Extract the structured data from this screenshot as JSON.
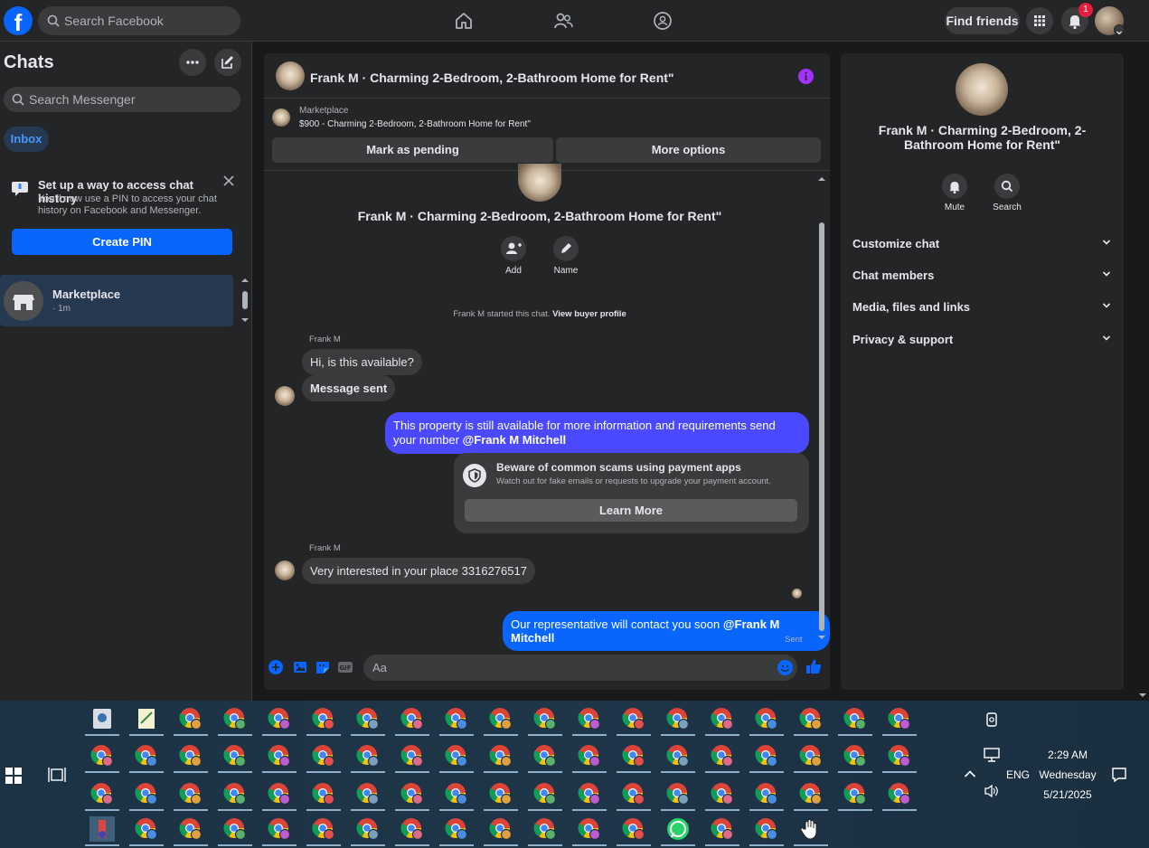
{
  "topbar": {
    "logo_letter": "f",
    "search_placeholder": "Search Facebook",
    "nav_icons": [
      "home-icon",
      "friends-icon",
      "groups-icon"
    ],
    "find_friends": "Find friends",
    "notif_count": "1"
  },
  "sidebar": {
    "title": "Chats",
    "search_placeholder": "Search Messenger",
    "inbox_label": "Inbox",
    "setup": {
      "title": "Set up a way to access chat history",
      "body": "You'll now use a PIN to access your chat history on Facebook and Messenger.",
      "button": "Create PIN"
    },
    "threads": [
      {
        "name": "Marketplace",
        "meta": "· 1m"
      }
    ]
  },
  "chat": {
    "header_title": "Frank M · Charming 2-Bedroom, 2-Bathroom Home for Rent\"",
    "listing": {
      "label": "Marketplace",
      "price_title": "$900 - Charming 2-Bedroom, 2-Bathroom Home for Rent\""
    },
    "mark_pending": "Mark as pending",
    "more_options": "More options",
    "intro_title": "Frank M · Charming 2-Bedroom, 2-Bathroom Home for Rent\"",
    "add_label": "Add",
    "name_label": "Name",
    "started_text": "Frank M started this chat.",
    "view_buyer": "View buyer profile",
    "messages": {
      "sender1": "Frank M",
      "m1": "Hi, is this available?",
      "m2": "Message sent",
      "m3_text": "This property is still available for more information and requirements send your number",
      "m3_mention": "@Frank M Mitchell",
      "scam_title": "Beware of common scams using payment apps",
      "scam_body": "Watch out for fake emails or requests to upgrade your payment account.",
      "learn_more": "Learn More",
      "sender2": "Frank M",
      "m4": "Very interested in your place 3316276517",
      "m5_text": "Our representative will contact you soon",
      "m5_mention": "@Frank M Mitchell",
      "status": "Sent"
    },
    "composer_placeholder": "Aa"
  },
  "details": {
    "title": "Frank M · Charming 2-Bedroom, 2-Bathroom Home for Rent\"",
    "mute": "Mute",
    "search": "Search",
    "sections": [
      "Customize chat",
      "Chat members",
      "Media, files and links",
      "Privacy & support"
    ]
  },
  "taskbar": {
    "time": "2:29 AM",
    "day": "Wednesday",
    "date": "5/21/2025",
    "lang": "ENG"
  },
  "colors": {
    "accent": "#0866ff",
    "outgoing_bubble": "#4a49ff",
    "incoming_bubble": "#3a3b3c",
    "panel": "#242526",
    "background": "#18191a"
  }
}
